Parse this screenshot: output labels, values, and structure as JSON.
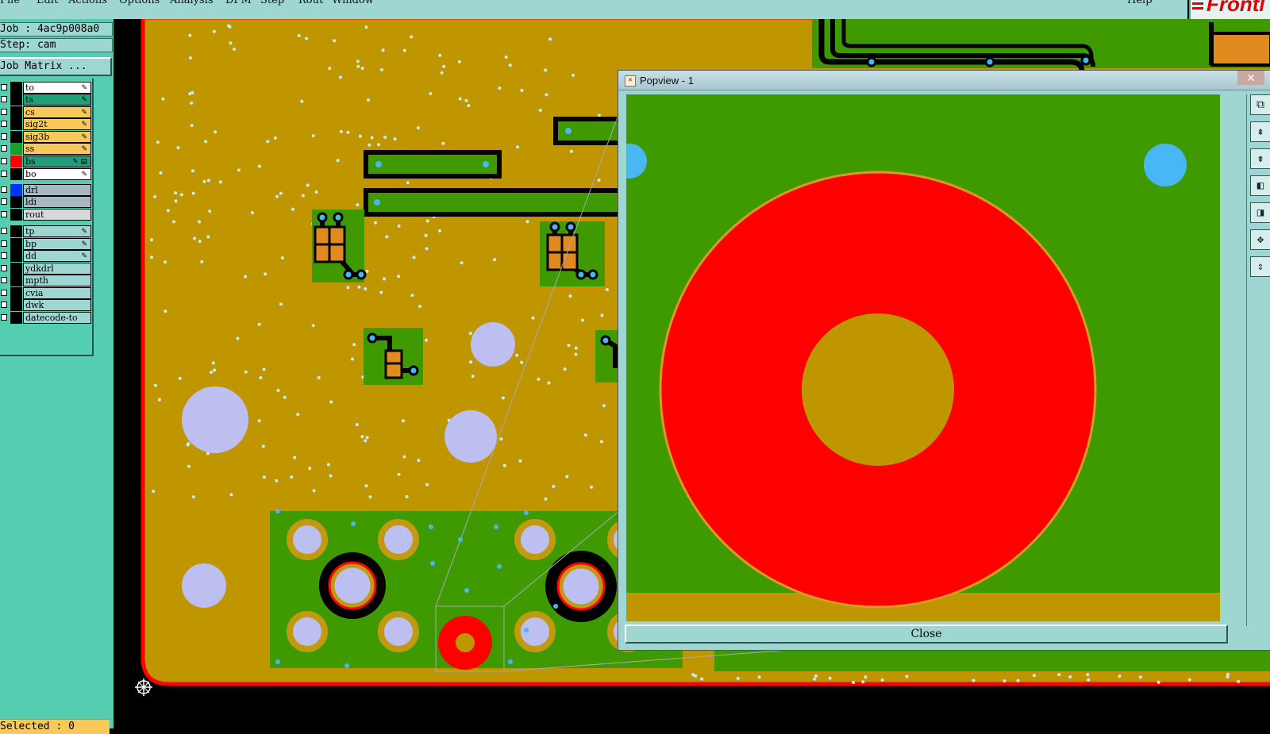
{
  "menubar": {
    "items": [
      "File",
      "Edit",
      "Actions",
      "Options",
      "Analysis",
      "DFM",
      "Step",
      "Rout",
      "Window"
    ],
    "help": "Help"
  },
  "info": {
    "job": "Job : 4ac9p008a0",
    "step": "Step: cam",
    "job_matrix": "Job Matrix ..."
  },
  "layers": [
    {
      "name": "to",
      "swatch": "#000000",
      "bg": "#ffffff",
      "mark": "✎"
    },
    {
      "name": "ts",
      "swatch": "#000000",
      "bg": "#1fa07a",
      "mark": "✎"
    },
    {
      "name": "cs",
      "swatch": "#000000",
      "bg": "#f8c85a",
      "mark": "✎"
    },
    {
      "name": "sig2t",
      "swatch": "#000000",
      "bg": "#f8c85a",
      "mark": "✎"
    },
    {
      "name": "sig3b",
      "swatch": "#000000",
      "bg": "#f8c85a",
      "mark": "✎"
    },
    {
      "name": "ss",
      "swatch": "#1f9c2e",
      "bg": "#f8c85a",
      "mark": "✎"
    },
    {
      "name": "bs",
      "swatch": "#ff0000",
      "bg": "#1fa07a",
      "mark": "✎ ▤"
    },
    {
      "name": "bo",
      "swatch": "#000000",
      "bg": "#ffffff",
      "mark": "✎"
    },
    {
      "name": "drl",
      "swatch": "#0033ff",
      "bg": "#a8b8c0",
      "mark": ""
    },
    {
      "name": "ldi",
      "swatch": "#000000",
      "bg": "#a8b8c0",
      "mark": ""
    },
    {
      "name": "rout",
      "swatch": "#000000",
      "bg": "#d8d8d8",
      "mark": ""
    },
    {
      "name": "tp",
      "swatch": "#000000",
      "bg": "#9ed6d2",
      "mark": "✎"
    },
    {
      "name": "bp",
      "swatch": "#000000",
      "bg": "#9ed6d2",
      "mark": "✎"
    },
    {
      "name": "dd",
      "swatch": "#000000",
      "bg": "#9ed6d2",
      "mark": "✎"
    },
    {
      "name": "ydkdrl",
      "swatch": "#000000",
      "bg": "#9ed6d2",
      "mark": ""
    },
    {
      "name": "mpth",
      "swatch": "#000000",
      "bg": "#9ed6d2",
      "mark": ""
    },
    {
      "name": "cvia",
      "swatch": "#000000",
      "bg": "#9ed6d2",
      "mark": ""
    },
    {
      "name": "dwk",
      "swatch": "#000000",
      "bg": "#9ed6d2",
      "mark": ""
    },
    {
      "name": "datecode-to",
      "swatch": "#000000",
      "bg": "#9ed6d2",
      "mark": ""
    }
  ],
  "status": {
    "selected": "Selected : 0"
  },
  "popview": {
    "title": "Popview - 1",
    "close_x": "✕",
    "close_label": "Close",
    "tools": [
      "zoom-window-icon",
      "zoom-in-icon",
      "zoom-out-icon",
      "pan-left-icon",
      "pan-right-icon",
      "fit-icon",
      "center-icon"
    ]
  },
  "colors": {
    "board_fill": "#bf9500",
    "copper_area": "#3f9900",
    "trace": "#000000",
    "pad": "#e08a20",
    "outline": "#ff0000",
    "hole_large": "#bdbff0",
    "via": "#4ab7f5",
    "ring_red": "#ff0000"
  }
}
